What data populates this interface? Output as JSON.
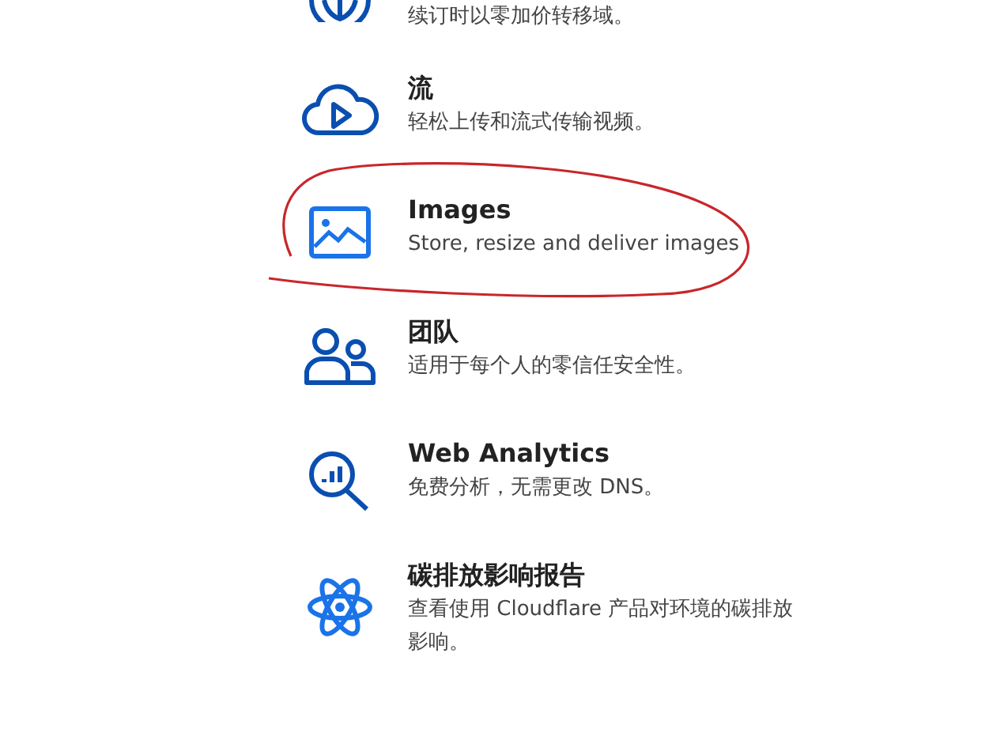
{
  "products": [
    {
      "kind": "globe",
      "description": "续订时以零加价转移域。"
    },
    {
      "kind": "cloud-play",
      "title": "流",
      "description": "轻松上传和流式传输视频。"
    },
    {
      "kind": "image",
      "title": "Images",
      "description": "Store, resize and deliver images"
    },
    {
      "kind": "people",
      "title": "团队",
      "description": "适用于每个人的零信任安全性。"
    },
    {
      "kind": "analytics",
      "title": "Web Analytics",
      "description": "免费分析，无需更改 DNS。"
    },
    {
      "kind": "atom",
      "title": "碳排放影响报告",
      "description": "查看使用 Cloudflare 产品对环境的碳排放影响。"
    }
  ]
}
